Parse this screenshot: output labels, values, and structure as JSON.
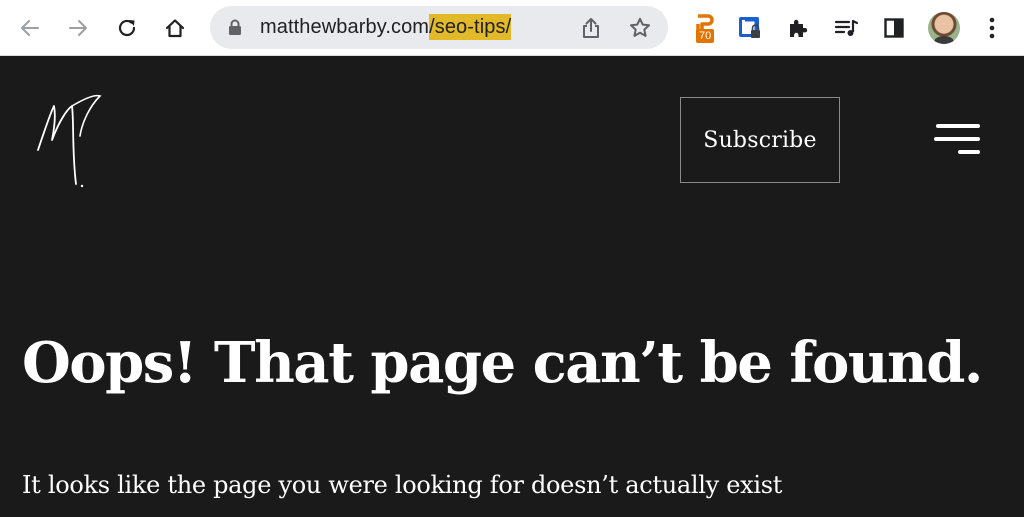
{
  "browser": {
    "url_prefix": "matthewbarby.com",
    "url_highlight": "/seo-tips/",
    "extension_badge": "70",
    "colors": {
      "url_highlight": "#e2b928",
      "badge": "#e37400"
    }
  },
  "icons": {
    "back": "arrow-left-icon",
    "forward": "arrow-right-icon",
    "reload": "reload-icon",
    "home": "home-icon",
    "lock": "lock-icon",
    "share": "share-icon",
    "star": "star-icon",
    "extensions": "puzzle-icon",
    "reading_list": "reading-list-icon",
    "side_panel": "side-panel-icon",
    "menu": "kebab-menu-icon"
  },
  "site": {
    "subscribe_label": "Subscribe",
    "background": "#1a1a1a"
  },
  "content": {
    "title": "Oops! That page can’t be found.",
    "subtitle": "It looks like the page you were looking for doesn’t actually exist"
  }
}
